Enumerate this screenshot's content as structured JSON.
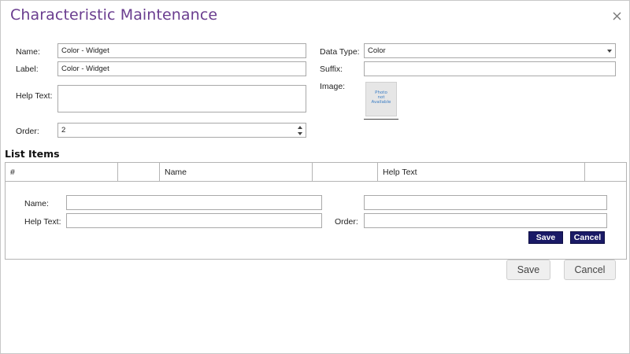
{
  "dialog": {
    "title": "Characteristic Maintenance",
    "close_icon": "close-icon"
  },
  "form": {
    "name_label": "Name:",
    "name_value": "Color - Widget",
    "label_label": "Label:",
    "label_value": "Color - Widget",
    "help_text_label": "Help Text:",
    "help_text_value": "",
    "order_label": "Order:",
    "order_value": "2",
    "data_type_label": "Data Type:",
    "data_type_value": "Color",
    "suffix_label": "Suffix:",
    "suffix_value": "",
    "image_label": "Image:",
    "image_placeholder": [
      "Photo",
      "not",
      "Available"
    ]
  },
  "list_items": {
    "title": "List Items",
    "columns": [
      "#",
      "",
      "Name",
      "",
      "Help Text",
      ""
    ],
    "editor": {
      "name_label": "Name:",
      "name_value": "",
      "help_text_label": "Help Text:",
      "help_text_value": "",
      "extra_value": "",
      "order_label": "Order:",
      "order_value": "",
      "save_label": "Save",
      "cancel_label": "Cancel"
    }
  },
  "footer": {
    "save_label": "Save",
    "cancel_label": "Cancel"
  },
  "colors": {
    "title": "#6a3d8f",
    "dark_button": "#1a1a66",
    "light_button": "#efefef"
  }
}
